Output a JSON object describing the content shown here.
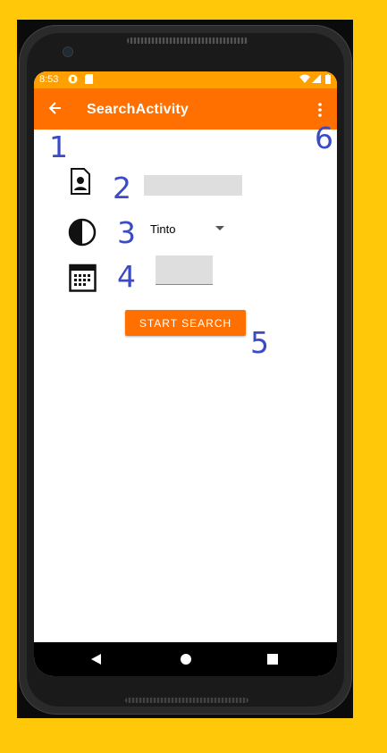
{
  "statusbar": {
    "time": "8:53"
  },
  "toolbar": {
    "title": "SearchActivity"
  },
  "annotations": {
    "n1": "1",
    "n2": "2",
    "n3": "3",
    "n4": "4",
    "n5": "5",
    "n6": "6"
  },
  "form": {
    "name_value": "",
    "color_selected": "Tinto",
    "date_value": "",
    "search_button_label": "START SEARCH"
  },
  "colors": {
    "toolbar": "#FF7000",
    "statusbar": "#FFA000",
    "background": "#FFC808",
    "annotation": "#3B4BC8"
  }
}
